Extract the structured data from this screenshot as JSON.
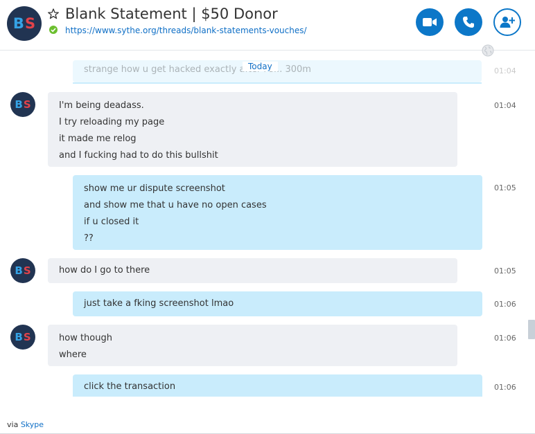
{
  "header": {
    "title": "Blank Statement | $50 Donor",
    "link": "https://www.sythe.org/threads/blank-statements-vouches/",
    "avatar_initials": [
      "B",
      "S"
    ],
    "status_color": "#6cbf2f",
    "accent_color": "#0c77c8",
    "icons": [
      "star-icon",
      "video-call-icon",
      "phone-call-icon",
      "add-contact-icon"
    ]
  },
  "conversation": {
    "date_divider": "Today",
    "faded_message": {
      "text": "strange how u get hacked exactly after i s... 300m",
      "time": "01:04"
    },
    "messages": [
      {
        "side": "in",
        "lines": [
          "I'm being deadass.",
          "I try reloading my page",
          "it made me relog",
          "and I fucking had to do this bullshit"
        ],
        "time": "01:04"
      },
      {
        "side": "out",
        "lines": [
          "show me ur dispute screenshot",
          "and show me that u have no open cases",
          "if u closed it",
          "??"
        ],
        "time": "01:05"
      },
      {
        "side": "in",
        "lines": [
          "how do I go to there"
        ],
        "time": "01:05"
      },
      {
        "side": "out",
        "lines": [
          "just take a fking screenshot lmao"
        ],
        "time": "01:06"
      },
      {
        "side": "in",
        "lines": [
          "how though",
          "where"
        ],
        "time": "01:06"
      },
      {
        "side": "out",
        "lines": [
          "click the transaction"
        ],
        "time": "01:06"
      }
    ]
  },
  "footer": {
    "prefix": "via ",
    "link_text": "Skype"
  }
}
